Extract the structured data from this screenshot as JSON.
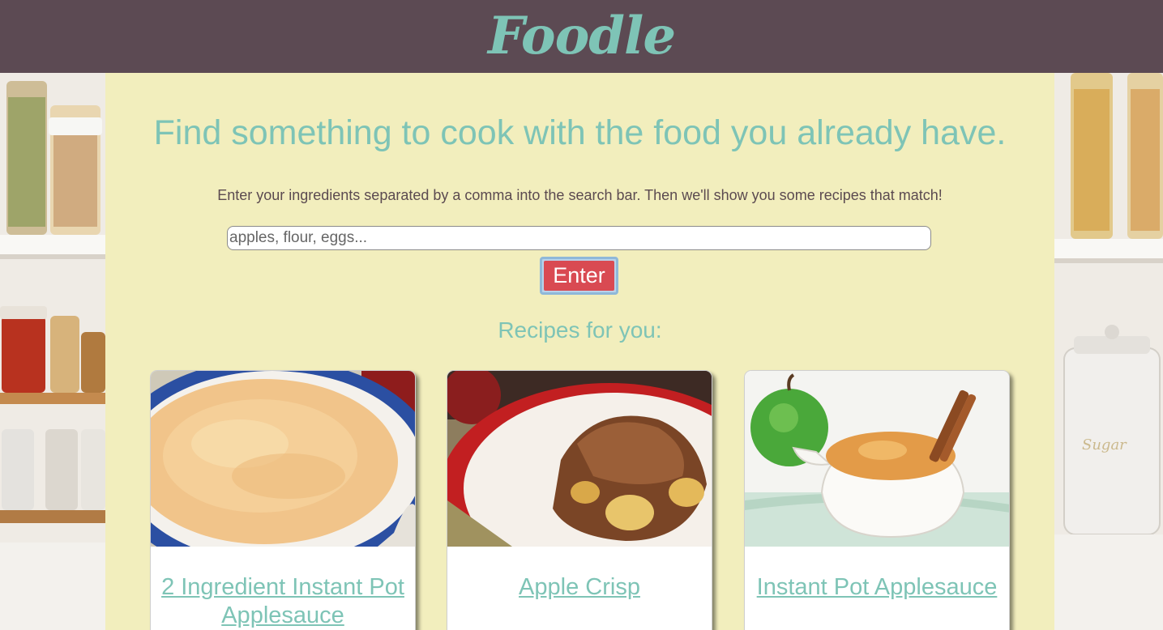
{
  "header": {
    "logo_text": "Foodle"
  },
  "main": {
    "title": "Find something to cook with the food you already have.",
    "instructions": "Enter your ingredients separated by a comma into the search bar. Then we'll show you some recipes that match!",
    "search": {
      "placeholder": "apples, flour, eggs...",
      "value": ""
    },
    "enter_label": "Enter",
    "recipes_heading": "Recipes for you:",
    "recipes": [
      {
        "title": "2 Ingredient Instant Pot Applesauce",
        "image": "applesauce-in-blue-bowl"
      },
      {
        "title": "Apple Crisp",
        "image": "apple-crisp-on-plate"
      },
      {
        "title": "Instant Pot Applesauce",
        "image": "applesauce-with-cinnamon-and-green-apple"
      }
    ]
  },
  "colors": {
    "header_bg": "#5c4a53",
    "accent_teal": "#7ec4b6",
    "panel_bg": "#f2eebd",
    "button_red": "#d94a52",
    "text_dark": "#5b4a50"
  }
}
